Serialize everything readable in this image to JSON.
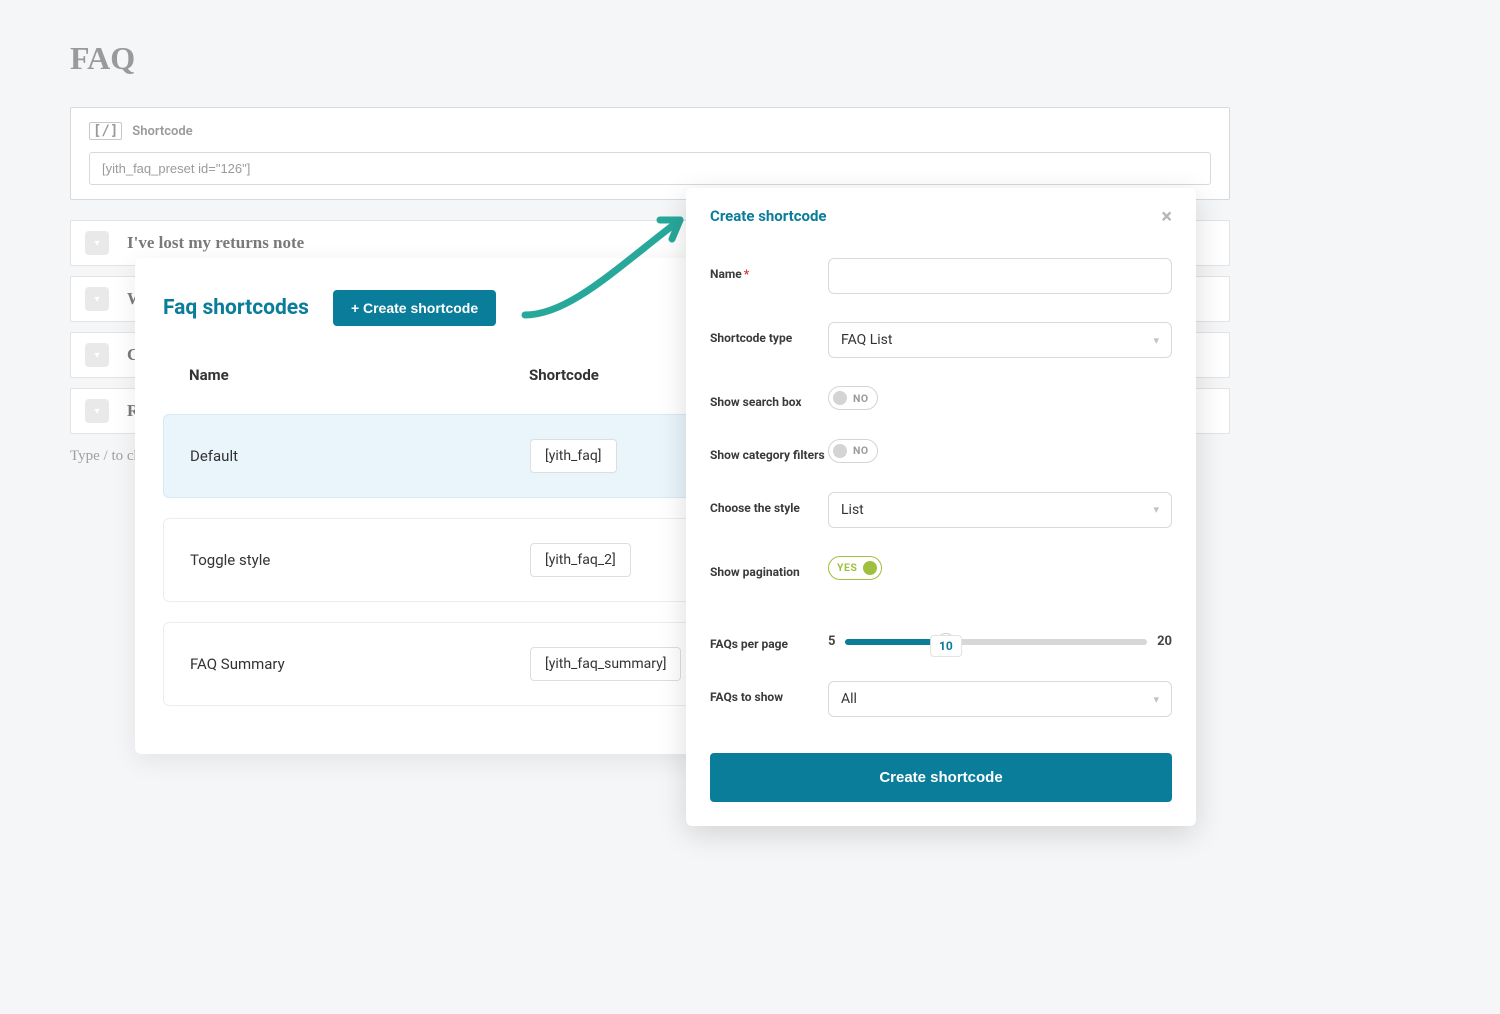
{
  "page": {
    "title": "FAQ",
    "shortcode_label": "Shortcode",
    "shortcode_value": "[yith_faq_preset id=\"126\"]",
    "hint": "Type / to ch"
  },
  "accordion": {
    "items": [
      {
        "title": "I've lost my returns note"
      },
      {
        "title": "Wh"
      },
      {
        "title": "Ca"
      },
      {
        "title": "Re"
      }
    ]
  },
  "left_card": {
    "title": "Faq shortcodes",
    "button": "+ Create shortcode",
    "columns": {
      "name": "Name",
      "shortcode": "Shortcode"
    },
    "rows": [
      {
        "name": "Default",
        "shortcode": "[yith_faq]",
        "highlight": true
      },
      {
        "name": "Toggle style",
        "shortcode": "[yith_faq_2]",
        "highlight": false
      },
      {
        "name": "FAQ Summary",
        "shortcode": "[yith_faq_summary]",
        "highlight": false
      }
    ]
  },
  "modal": {
    "title": "Create shortcode",
    "fields": {
      "name_label": "Name",
      "name_value": "",
      "type_label": "Shortcode type",
      "type_value": "FAQ List",
      "search_label": "Show search box",
      "search_value": "NO",
      "category_label": "Show category filters",
      "category_value": "NO",
      "style_label": "Choose the style",
      "style_value": "List",
      "pagination_label": "Show pagination",
      "pagination_value": "YES",
      "perpage_label": "FAQs per page",
      "perpage_min": "5",
      "perpage_max": "20",
      "perpage_value": "10",
      "show_label": "FAQs to show",
      "show_value": "All"
    },
    "submit": "Create shortcode"
  }
}
